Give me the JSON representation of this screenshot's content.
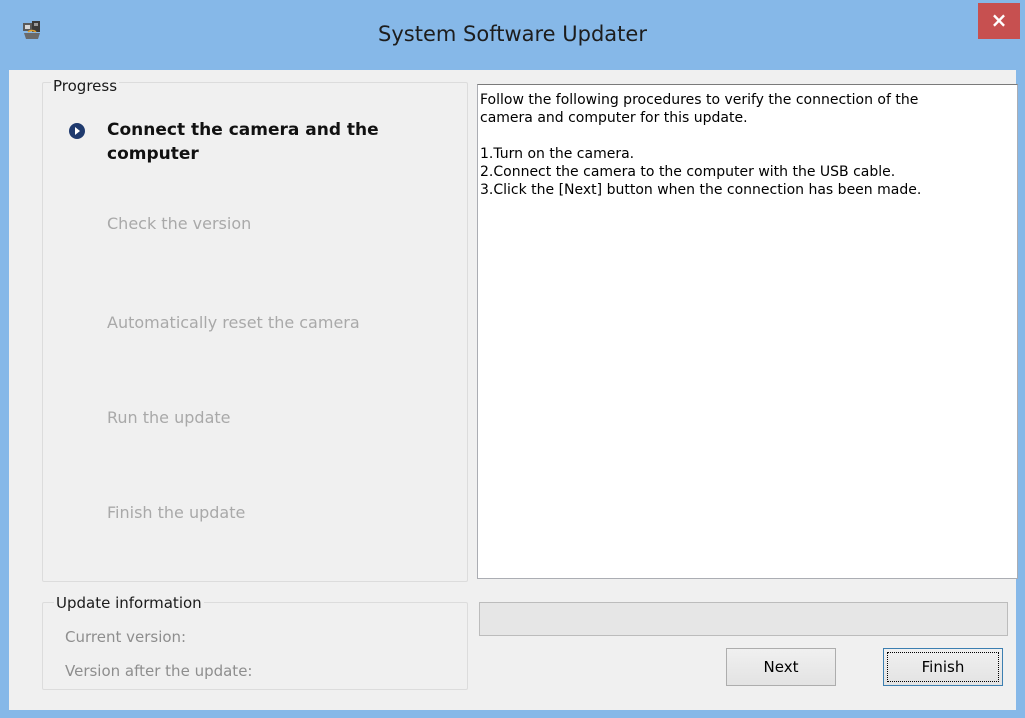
{
  "window": {
    "title": "System Software Updater",
    "close_label": "×",
    "accent_color": "#86b8e8",
    "close_color": "#c75050"
  },
  "progress": {
    "legend": "Progress",
    "steps": [
      {
        "label": "Connect the camera and the",
        "label2": "computer",
        "state": "current"
      },
      {
        "label": "Check the version",
        "state": "pending"
      },
      {
        "label": "Automatically reset the camera",
        "state": "pending"
      },
      {
        "label": "Run the update",
        "state": "pending"
      },
      {
        "label": "Finish the update",
        "state": "pending"
      }
    ]
  },
  "update_info": {
    "legend": "Update information",
    "current_version_label": "Current version:",
    "after_version_label": "Version after the update:"
  },
  "instructions": {
    "lines": [
      "Follow the following procedures to verify the connection of the",
      "camera and computer for this update.",
      "",
      "1.Turn on the camera.",
      "2.Connect the camera to the computer with the USB cable.",
      "3.Click the [Next] button when the connection has been made."
    ]
  },
  "progress_bar": {
    "value": 0
  },
  "buttons": {
    "next_label": "Next",
    "finish_label": "Finish"
  }
}
